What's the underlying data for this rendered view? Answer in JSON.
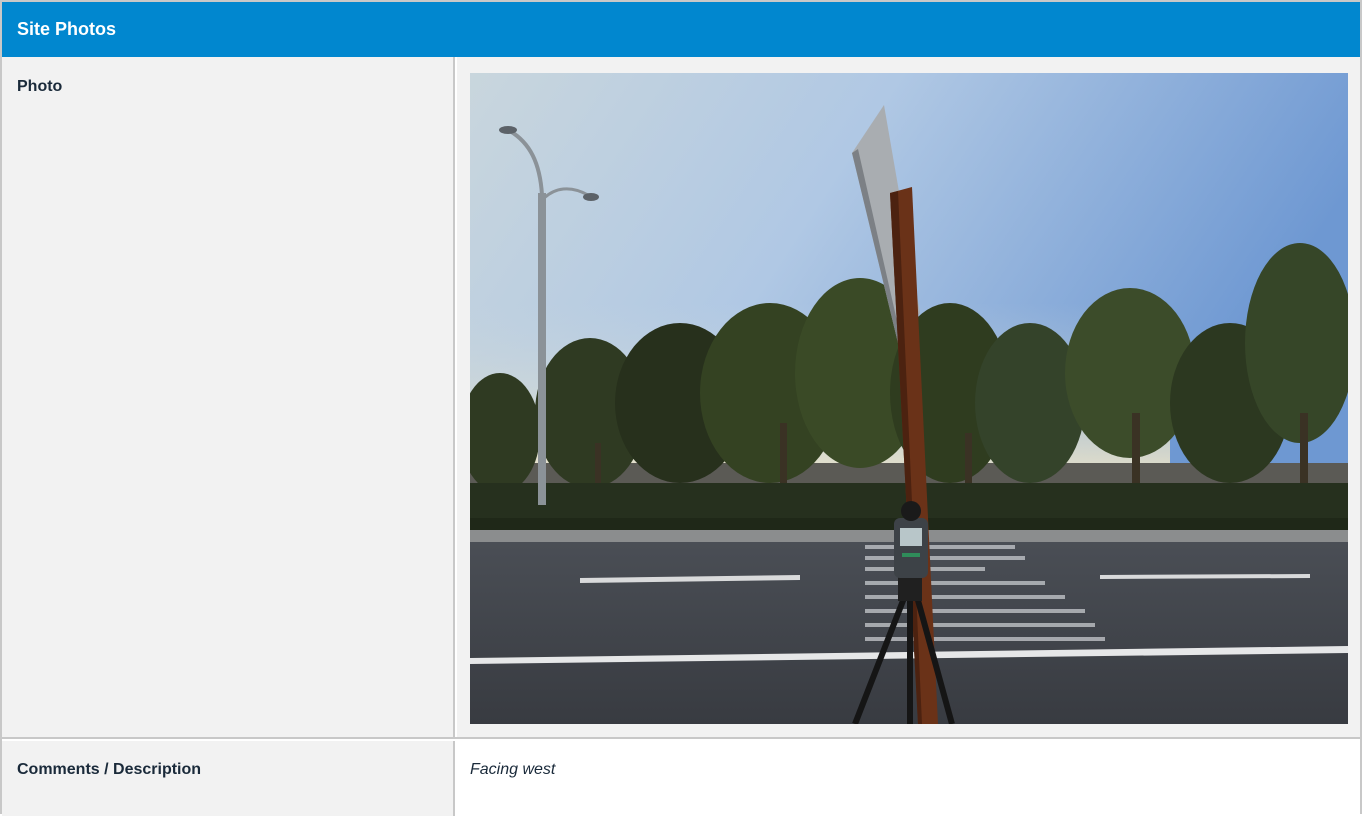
{
  "header": {
    "title": "Site Photos"
  },
  "rows": {
    "photo": {
      "label": "Photo"
    },
    "comments": {
      "label": "Comments / Description",
      "value": "Facing west"
    }
  },
  "colors": {
    "header_bg": "#0187cf",
    "label_bg": "#f2f2f2",
    "border": "#c8c8c8"
  }
}
